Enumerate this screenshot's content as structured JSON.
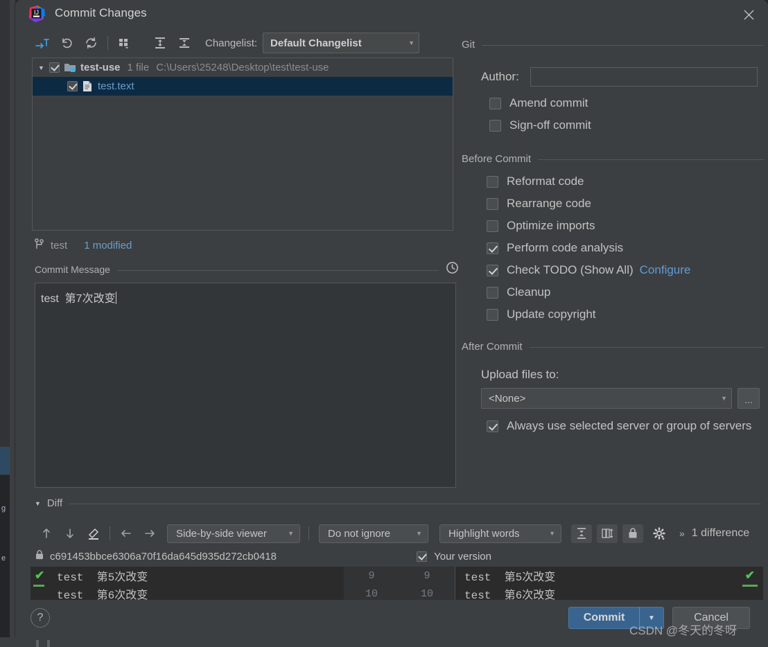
{
  "window": {
    "title": "Commit Changes",
    "logo_icon": "intellij-idea-logo",
    "close_icon": "close-icon"
  },
  "toolbar": {
    "icons": [
      {
        "name": "show-diff-icon",
        "tip": "Show Diff"
      },
      {
        "name": "rollback-icon",
        "tip": "Revert"
      },
      {
        "name": "refresh-icon",
        "tip": "Refresh"
      },
      {
        "name": "group-by-icon",
        "tip": "Group By"
      },
      {
        "name": "expand-all-icon",
        "tip": "Expand All"
      },
      {
        "name": "collapse-all-icon",
        "tip": "Collapse All"
      }
    ],
    "changelist_label": "Changelist:",
    "changelist_value": "Default Changelist"
  },
  "file_tree": {
    "root": {
      "name": "test-use",
      "file_count": "1 file",
      "path": "C:\\Users\\25248\\Desktop\\test\\test-use",
      "checked": true,
      "expanded": true
    },
    "children": [
      {
        "name": "test.text",
        "checked": true,
        "selected": true
      }
    ]
  },
  "branch_bar": {
    "branch_icon": "git-branch-icon",
    "branch": "test",
    "modified": "1 modified"
  },
  "commit_message": {
    "section_label": "Commit Message",
    "history_icon": "clock-history-icon",
    "value": "test  第7次改变"
  },
  "git_section": {
    "title": "Git",
    "author_label": "Author:",
    "author_value": "",
    "checkboxes": [
      {
        "label": "Amend commit",
        "checked": false
      },
      {
        "label": "Sign-off commit",
        "checked": false
      }
    ]
  },
  "before_commit": {
    "title": "Before Commit",
    "checkboxes": [
      {
        "label": "Reformat code",
        "checked": false
      },
      {
        "label": "Rearrange code",
        "checked": false
      },
      {
        "label": "Optimize imports",
        "checked": false
      },
      {
        "label": "Perform code analysis",
        "checked": true
      },
      {
        "label": "Check TODO (Show All)",
        "checked": true,
        "link": "Configure"
      },
      {
        "label": "Cleanup",
        "checked": false
      },
      {
        "label": "Update copyright",
        "checked": false
      }
    ]
  },
  "after_commit": {
    "title": "After Commit",
    "upload_label": "Upload files to:",
    "upload_value": "<None>",
    "browse_label": "...",
    "always_label": "Always use selected server or group of servers",
    "always_checked": true
  },
  "diff": {
    "section_label": "Diff",
    "nav_icons": [
      {
        "name": "previous-difference-icon"
      },
      {
        "name": "next-difference-icon"
      },
      {
        "name": "edit-icon"
      },
      {
        "name": "accept-left-icon"
      },
      {
        "name": "accept-right-icon"
      }
    ],
    "viewer_mode": "Side-by-side viewer",
    "ignore_mode": "Do not ignore",
    "highlight_mode": "Highlight words",
    "buttons": [
      {
        "name": "collapse-unchanged-icon"
      },
      {
        "name": "synchronize-scroll-icon"
      },
      {
        "name": "lock-readonly-icon"
      },
      {
        "name": "settings-gear-icon"
      }
    ],
    "more_label": "»",
    "difference_count": "1 difference",
    "left_lock_icon": "lock-icon",
    "left_revision": "c691453bbce6306a70f16da645d935d272cb0418",
    "right_checkbox_label": "Your version",
    "right_checkbox_checked": true,
    "lines": [
      {
        "left": "test  第5次改变",
        "line_left": "9",
        "line_right": "9",
        "right": "test  第5次改变"
      },
      {
        "left": "test  第6次改变",
        "line_left": "10",
        "line_right": "10",
        "right": "test  第6次改变"
      }
    ]
  },
  "bottom": {
    "help_label": "?",
    "commit_label": "Commit",
    "commit_dropdown_icon": "chevron-down-icon",
    "cancel_label": "Cancel"
  },
  "watermark": "CSDN @冬天的冬呀",
  "colors": {
    "dialog_bg": "#3c3f41",
    "selection": "#0d2a43",
    "accent_link": "#5e9cd8",
    "commit_button": "#39648f",
    "diff_added": "#52c252",
    "file_name": "#6b9ec8"
  }
}
